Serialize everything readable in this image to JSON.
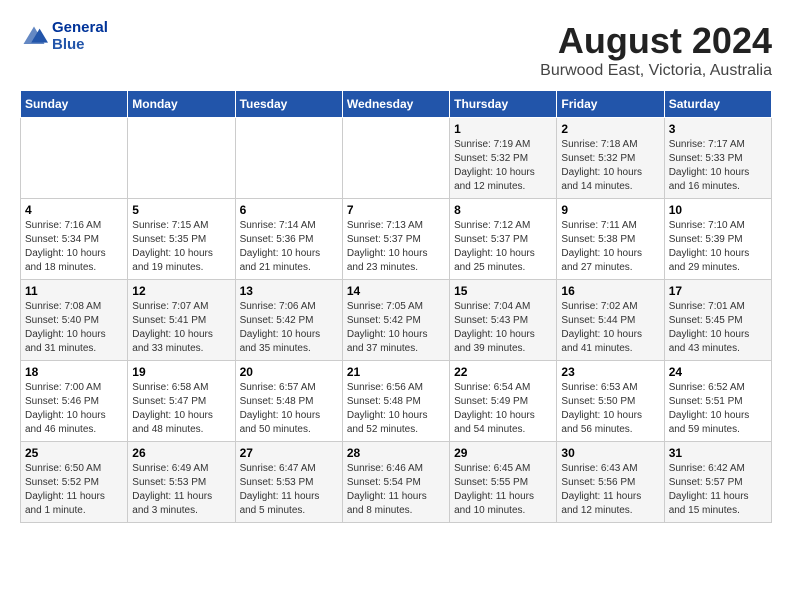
{
  "header": {
    "logo_line1": "General",
    "logo_line2": "Blue",
    "title": "August 2024",
    "subtitle": "Burwood East, Victoria, Australia"
  },
  "days_of_week": [
    "Sunday",
    "Monday",
    "Tuesday",
    "Wednesday",
    "Thursday",
    "Friday",
    "Saturday"
  ],
  "weeks": [
    [
      {
        "day": "",
        "info": ""
      },
      {
        "day": "",
        "info": ""
      },
      {
        "day": "",
        "info": ""
      },
      {
        "day": "",
        "info": ""
      },
      {
        "day": "1",
        "info": "Sunrise: 7:19 AM\nSunset: 5:32 PM\nDaylight: 10 hours\nand 12 minutes."
      },
      {
        "day": "2",
        "info": "Sunrise: 7:18 AM\nSunset: 5:32 PM\nDaylight: 10 hours\nand 14 minutes."
      },
      {
        "day": "3",
        "info": "Sunrise: 7:17 AM\nSunset: 5:33 PM\nDaylight: 10 hours\nand 16 minutes."
      }
    ],
    [
      {
        "day": "4",
        "info": "Sunrise: 7:16 AM\nSunset: 5:34 PM\nDaylight: 10 hours\nand 18 minutes."
      },
      {
        "day": "5",
        "info": "Sunrise: 7:15 AM\nSunset: 5:35 PM\nDaylight: 10 hours\nand 19 minutes."
      },
      {
        "day": "6",
        "info": "Sunrise: 7:14 AM\nSunset: 5:36 PM\nDaylight: 10 hours\nand 21 minutes."
      },
      {
        "day": "7",
        "info": "Sunrise: 7:13 AM\nSunset: 5:37 PM\nDaylight: 10 hours\nand 23 minutes."
      },
      {
        "day": "8",
        "info": "Sunrise: 7:12 AM\nSunset: 5:37 PM\nDaylight: 10 hours\nand 25 minutes."
      },
      {
        "day": "9",
        "info": "Sunrise: 7:11 AM\nSunset: 5:38 PM\nDaylight: 10 hours\nand 27 minutes."
      },
      {
        "day": "10",
        "info": "Sunrise: 7:10 AM\nSunset: 5:39 PM\nDaylight: 10 hours\nand 29 minutes."
      }
    ],
    [
      {
        "day": "11",
        "info": "Sunrise: 7:08 AM\nSunset: 5:40 PM\nDaylight: 10 hours\nand 31 minutes."
      },
      {
        "day": "12",
        "info": "Sunrise: 7:07 AM\nSunset: 5:41 PM\nDaylight: 10 hours\nand 33 minutes."
      },
      {
        "day": "13",
        "info": "Sunrise: 7:06 AM\nSunset: 5:42 PM\nDaylight: 10 hours\nand 35 minutes."
      },
      {
        "day": "14",
        "info": "Sunrise: 7:05 AM\nSunset: 5:42 PM\nDaylight: 10 hours\nand 37 minutes."
      },
      {
        "day": "15",
        "info": "Sunrise: 7:04 AM\nSunset: 5:43 PM\nDaylight: 10 hours\nand 39 minutes."
      },
      {
        "day": "16",
        "info": "Sunrise: 7:02 AM\nSunset: 5:44 PM\nDaylight: 10 hours\nand 41 minutes."
      },
      {
        "day": "17",
        "info": "Sunrise: 7:01 AM\nSunset: 5:45 PM\nDaylight: 10 hours\nand 43 minutes."
      }
    ],
    [
      {
        "day": "18",
        "info": "Sunrise: 7:00 AM\nSunset: 5:46 PM\nDaylight: 10 hours\nand 46 minutes."
      },
      {
        "day": "19",
        "info": "Sunrise: 6:58 AM\nSunset: 5:47 PM\nDaylight: 10 hours\nand 48 minutes."
      },
      {
        "day": "20",
        "info": "Sunrise: 6:57 AM\nSunset: 5:48 PM\nDaylight: 10 hours\nand 50 minutes."
      },
      {
        "day": "21",
        "info": "Sunrise: 6:56 AM\nSunset: 5:48 PM\nDaylight: 10 hours\nand 52 minutes."
      },
      {
        "day": "22",
        "info": "Sunrise: 6:54 AM\nSunset: 5:49 PM\nDaylight: 10 hours\nand 54 minutes."
      },
      {
        "day": "23",
        "info": "Sunrise: 6:53 AM\nSunset: 5:50 PM\nDaylight: 10 hours\nand 56 minutes."
      },
      {
        "day": "24",
        "info": "Sunrise: 6:52 AM\nSunset: 5:51 PM\nDaylight: 10 hours\nand 59 minutes."
      }
    ],
    [
      {
        "day": "25",
        "info": "Sunrise: 6:50 AM\nSunset: 5:52 PM\nDaylight: 11 hours\nand 1 minute."
      },
      {
        "day": "26",
        "info": "Sunrise: 6:49 AM\nSunset: 5:53 PM\nDaylight: 11 hours\nand 3 minutes."
      },
      {
        "day": "27",
        "info": "Sunrise: 6:47 AM\nSunset: 5:53 PM\nDaylight: 11 hours\nand 5 minutes."
      },
      {
        "day": "28",
        "info": "Sunrise: 6:46 AM\nSunset: 5:54 PM\nDaylight: 11 hours\nand 8 minutes."
      },
      {
        "day": "29",
        "info": "Sunrise: 6:45 AM\nSunset: 5:55 PM\nDaylight: 11 hours\nand 10 minutes."
      },
      {
        "day": "30",
        "info": "Sunrise: 6:43 AM\nSunset: 5:56 PM\nDaylight: 11 hours\nand 12 minutes."
      },
      {
        "day": "31",
        "info": "Sunrise: 6:42 AM\nSunset: 5:57 PM\nDaylight: 11 hours\nand 15 minutes."
      }
    ]
  ]
}
